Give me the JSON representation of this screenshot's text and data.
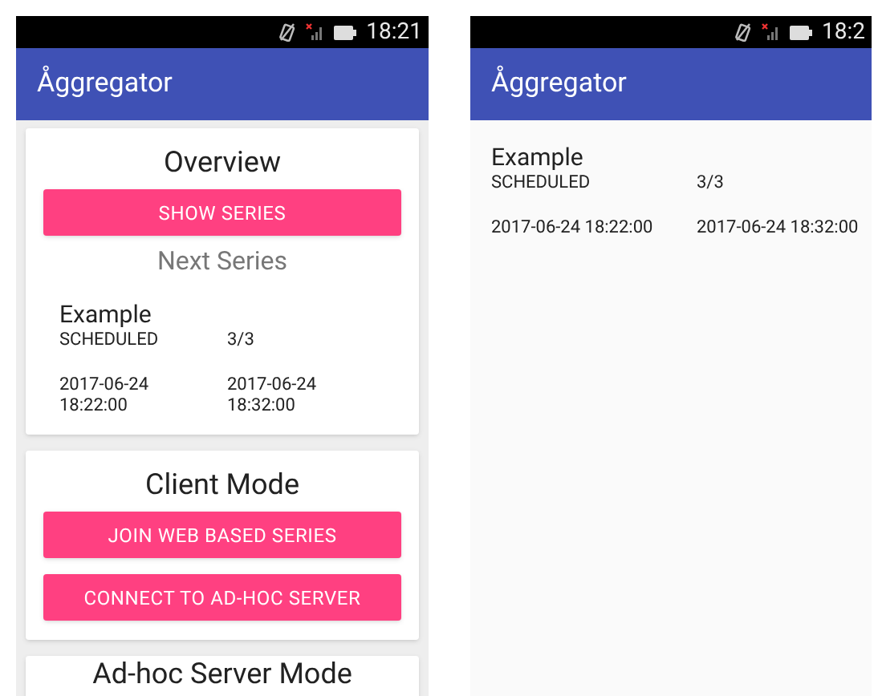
{
  "screens": [
    {
      "kind": "main",
      "status_bar": {
        "time": "18:21"
      },
      "app_bar": {
        "title": "Åggregator"
      },
      "cards": [
        {
          "title": "Overview",
          "buttons": [
            "SHOW SERIES"
          ],
          "subtitle": "Next Series",
          "series": {
            "name": "Example",
            "status": "SCHEDULED",
            "count": "3/3",
            "start": "2017-06-24 18:22:00",
            "end": "2017-06-24 18:32:00"
          }
        },
        {
          "title": "Client Mode",
          "buttons": [
            "JOIN WEB BASED SERIES",
            "CONNECT TO AD-HOC SERVER"
          ]
        },
        {
          "title": "Ad-hoc Server Mode"
        }
      ]
    },
    {
      "kind": "detail",
      "status_bar": {
        "time": "18:2"
      },
      "app_bar": {
        "title": "Åggregator"
      },
      "series": [
        {
          "name": "Example",
          "status": "SCHEDULED",
          "count": "3/3",
          "start": "2017-06-24 18:22:00",
          "end": "2017-06-24 18:32:00"
        }
      ]
    }
  ]
}
